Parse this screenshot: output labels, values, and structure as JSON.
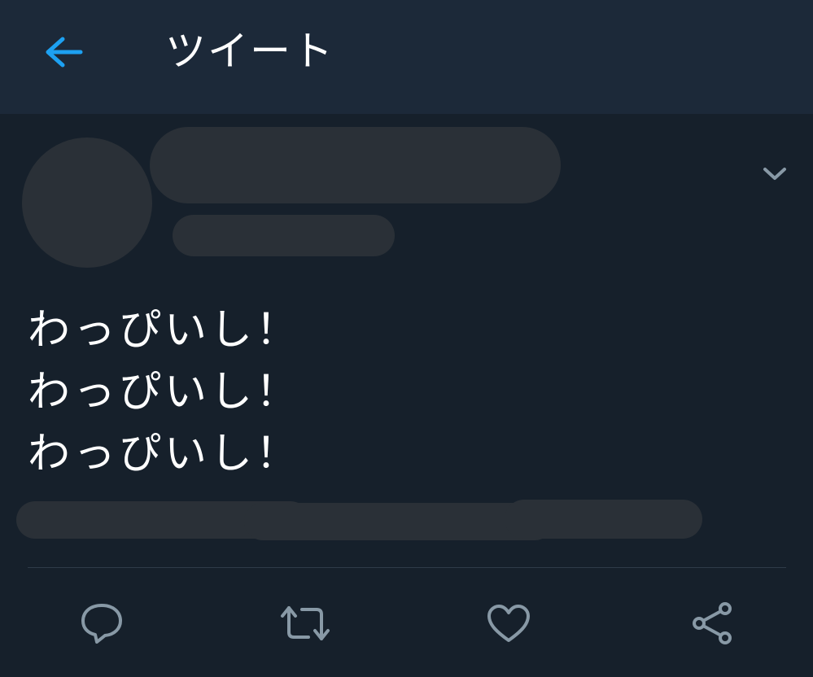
{
  "header": {
    "title": "ツイート",
    "back_icon": "arrow-left-icon",
    "accent_color": "#1da1f2"
  },
  "tweet": {
    "text": "わっぴいし！\nわっぴいし！\nわっぴいし！",
    "menu_icon": "chevron-down-icon"
  },
  "actions": [
    {
      "name": "reply",
      "icon": "speech-bubble-icon"
    },
    {
      "name": "retweet",
      "icon": "retweet-icon"
    },
    {
      "name": "like",
      "icon": "heart-icon"
    },
    {
      "name": "share",
      "icon": "share-icon"
    }
  ]
}
